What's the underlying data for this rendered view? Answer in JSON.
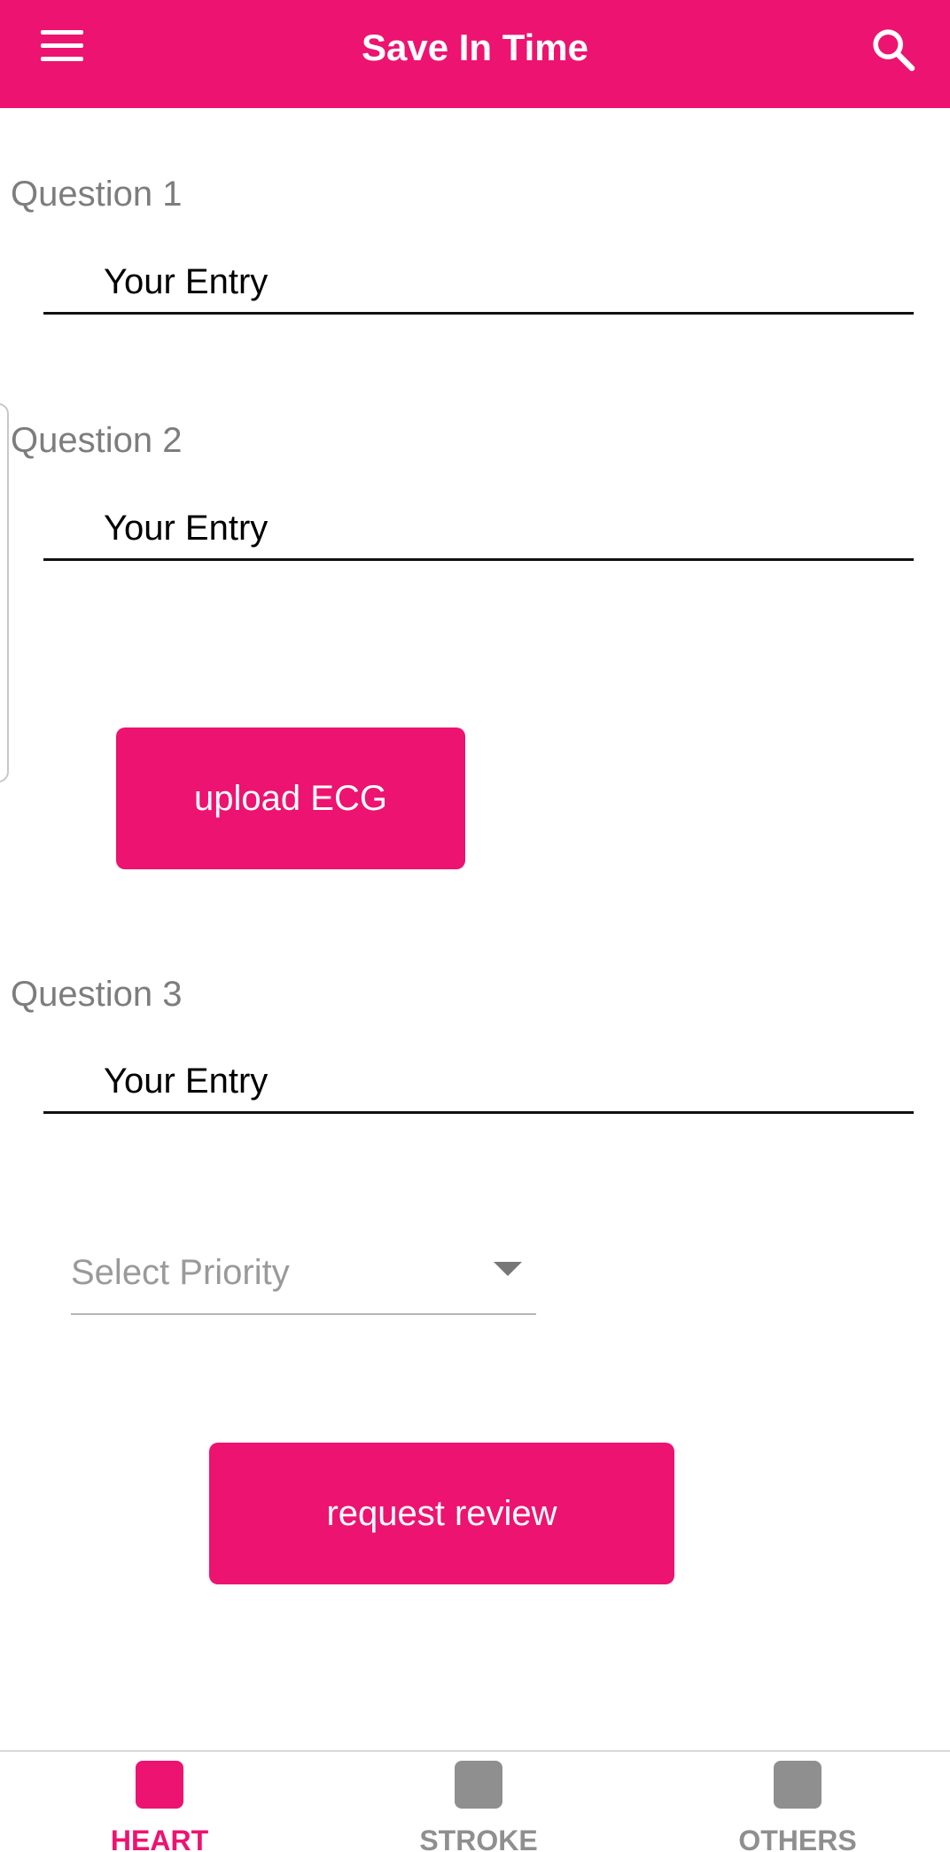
{
  "appbar": {
    "title": "Save In Time",
    "menu_icon": "hamburger-menu-icon",
    "search_icon": "search-icon",
    "color": "#ED1370"
  },
  "questions": [
    {
      "label": "Question 1",
      "value": "Your Entry"
    },
    {
      "label": "Question 2",
      "value": "Your Entry"
    },
    {
      "label": "Question 3",
      "value": "Your Entry"
    }
  ],
  "upload_button": {
    "label": "upload ECG"
  },
  "priority_select": {
    "placeholder": "Select Priority",
    "icon": "dropdown-arrow-icon"
  },
  "review_button": {
    "label": "request review"
  },
  "bottom_nav": {
    "items": [
      {
        "label": "HEART",
        "active": true
      },
      {
        "label": "STROKE",
        "active": false
      },
      {
        "label": "OTHERS",
        "active": false
      }
    ],
    "active_color": "#ED1370",
    "inactive_color": "#8F8F8F"
  }
}
